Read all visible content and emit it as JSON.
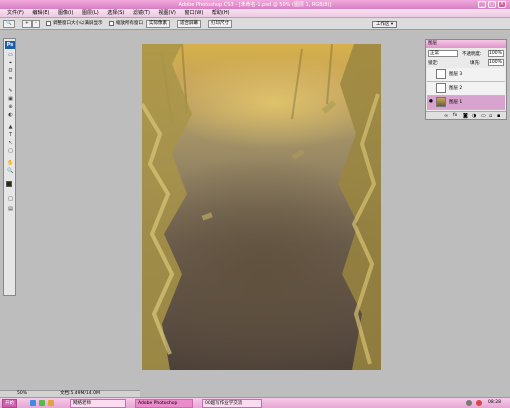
{
  "window": {
    "title": "Adobe Photoshop CS3 - [未命名-1.psd @ 50% (图层 1, RGB/8)]",
    "controls": [
      "_",
      "□",
      "×"
    ]
  },
  "menu": [
    "文件(F)",
    "编辑(E)",
    "图像(I)",
    "图层(L)",
    "选择(S)",
    "滤镜(T)",
    "视图(V)",
    "窗口(W)",
    "帮助(H)"
  ],
  "options": {
    "tool_icon": "zoom-icon",
    "zoom_in": "+",
    "zoom_out": "-",
    "resize_windows_label": "调整窗口大小以满屏显示",
    "zoom_all_label": "缩放所有窗口",
    "actual_pixels": "实际像素",
    "fit_screen": "适合屏幕",
    "print_size": "打印尺寸",
    "workspace": "工作区 ▾"
  },
  "toolbox": {
    "logo": "Ps",
    "tools": [
      "▭",
      "⌖",
      "ʘ",
      "⌗",
      "✎",
      "▣",
      "⊕",
      "◐",
      "▲",
      "T",
      "↖",
      "▢",
      "✋",
      "🔍",
      "■",
      "□",
      "▤"
    ]
  },
  "layers_panel": {
    "title": "图层",
    "blend_mode": "正常",
    "opacity_label": "不透明度:",
    "opacity_value": "100%",
    "lock_label": "锁定:",
    "fill_label": "填充:",
    "fill_value": "100%",
    "layers": [
      {
        "name": "图层 3",
        "visible": false,
        "selected": false
      },
      {
        "name": "图层 2",
        "visible": false,
        "selected": false
      },
      {
        "name": "图层 1",
        "visible": true,
        "selected": true
      }
    ],
    "footer_icons": [
      "link-icon",
      "fx-icon",
      "mask-icon",
      "adjustment-icon",
      "folder-icon",
      "new-layer-icon",
      "trash-icon"
    ]
  },
  "status": {
    "zoom": "50%",
    "doc": "文档:5.49M/14.0M"
  },
  "taskbar": {
    "start": "开始",
    "items": [
      "网络老师",
      "Adobe Photoshop",
      "00超写作业学交流"
    ],
    "clock": "08:28"
  },
  "colors": {
    "titlebar": "#e597cf",
    "canvas_bg": "#bdbdbd",
    "selected_layer": "#d9a3cf"
  }
}
